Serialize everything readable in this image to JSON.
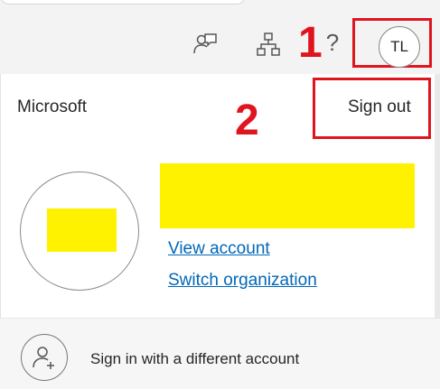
{
  "topbar": {
    "icons": {
      "feedback": "feedback-icon",
      "org_chart": "org-chart-icon",
      "help": "?"
    },
    "avatar_initials": "TL"
  },
  "annotations": {
    "step1": "1",
    "step2": "2",
    "color": "#e0141e"
  },
  "account_panel": {
    "brand": "Microsoft",
    "sign_out": "Sign out",
    "links": {
      "view_account": "View account",
      "switch_organization": "Switch organization"
    },
    "sign_in_different": "Sign in with a different account"
  },
  "colors": {
    "redaction": "#fff200",
    "link": "#0067b8"
  }
}
